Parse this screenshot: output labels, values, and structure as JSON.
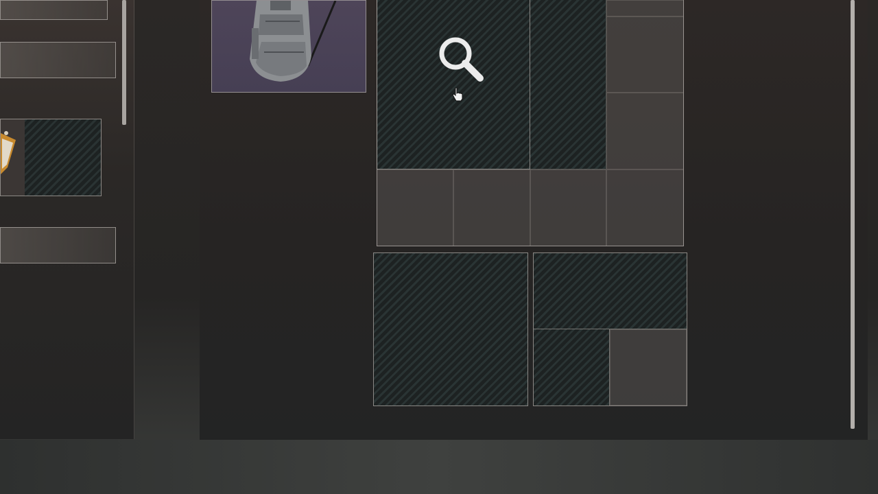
{
  "inventory": {
    "backpack_item": {
      "icon": "backpack-icon",
      "accent_color": "#4b4256"
    },
    "search_slot": {
      "icon": "magnifier-icon",
      "state": "searching"
    },
    "cursor": {
      "icon": "hand-cursor-icon"
    },
    "left_item": {
      "icon": "knife-icon",
      "accent_color": "#b07a2a"
    }
  }
}
